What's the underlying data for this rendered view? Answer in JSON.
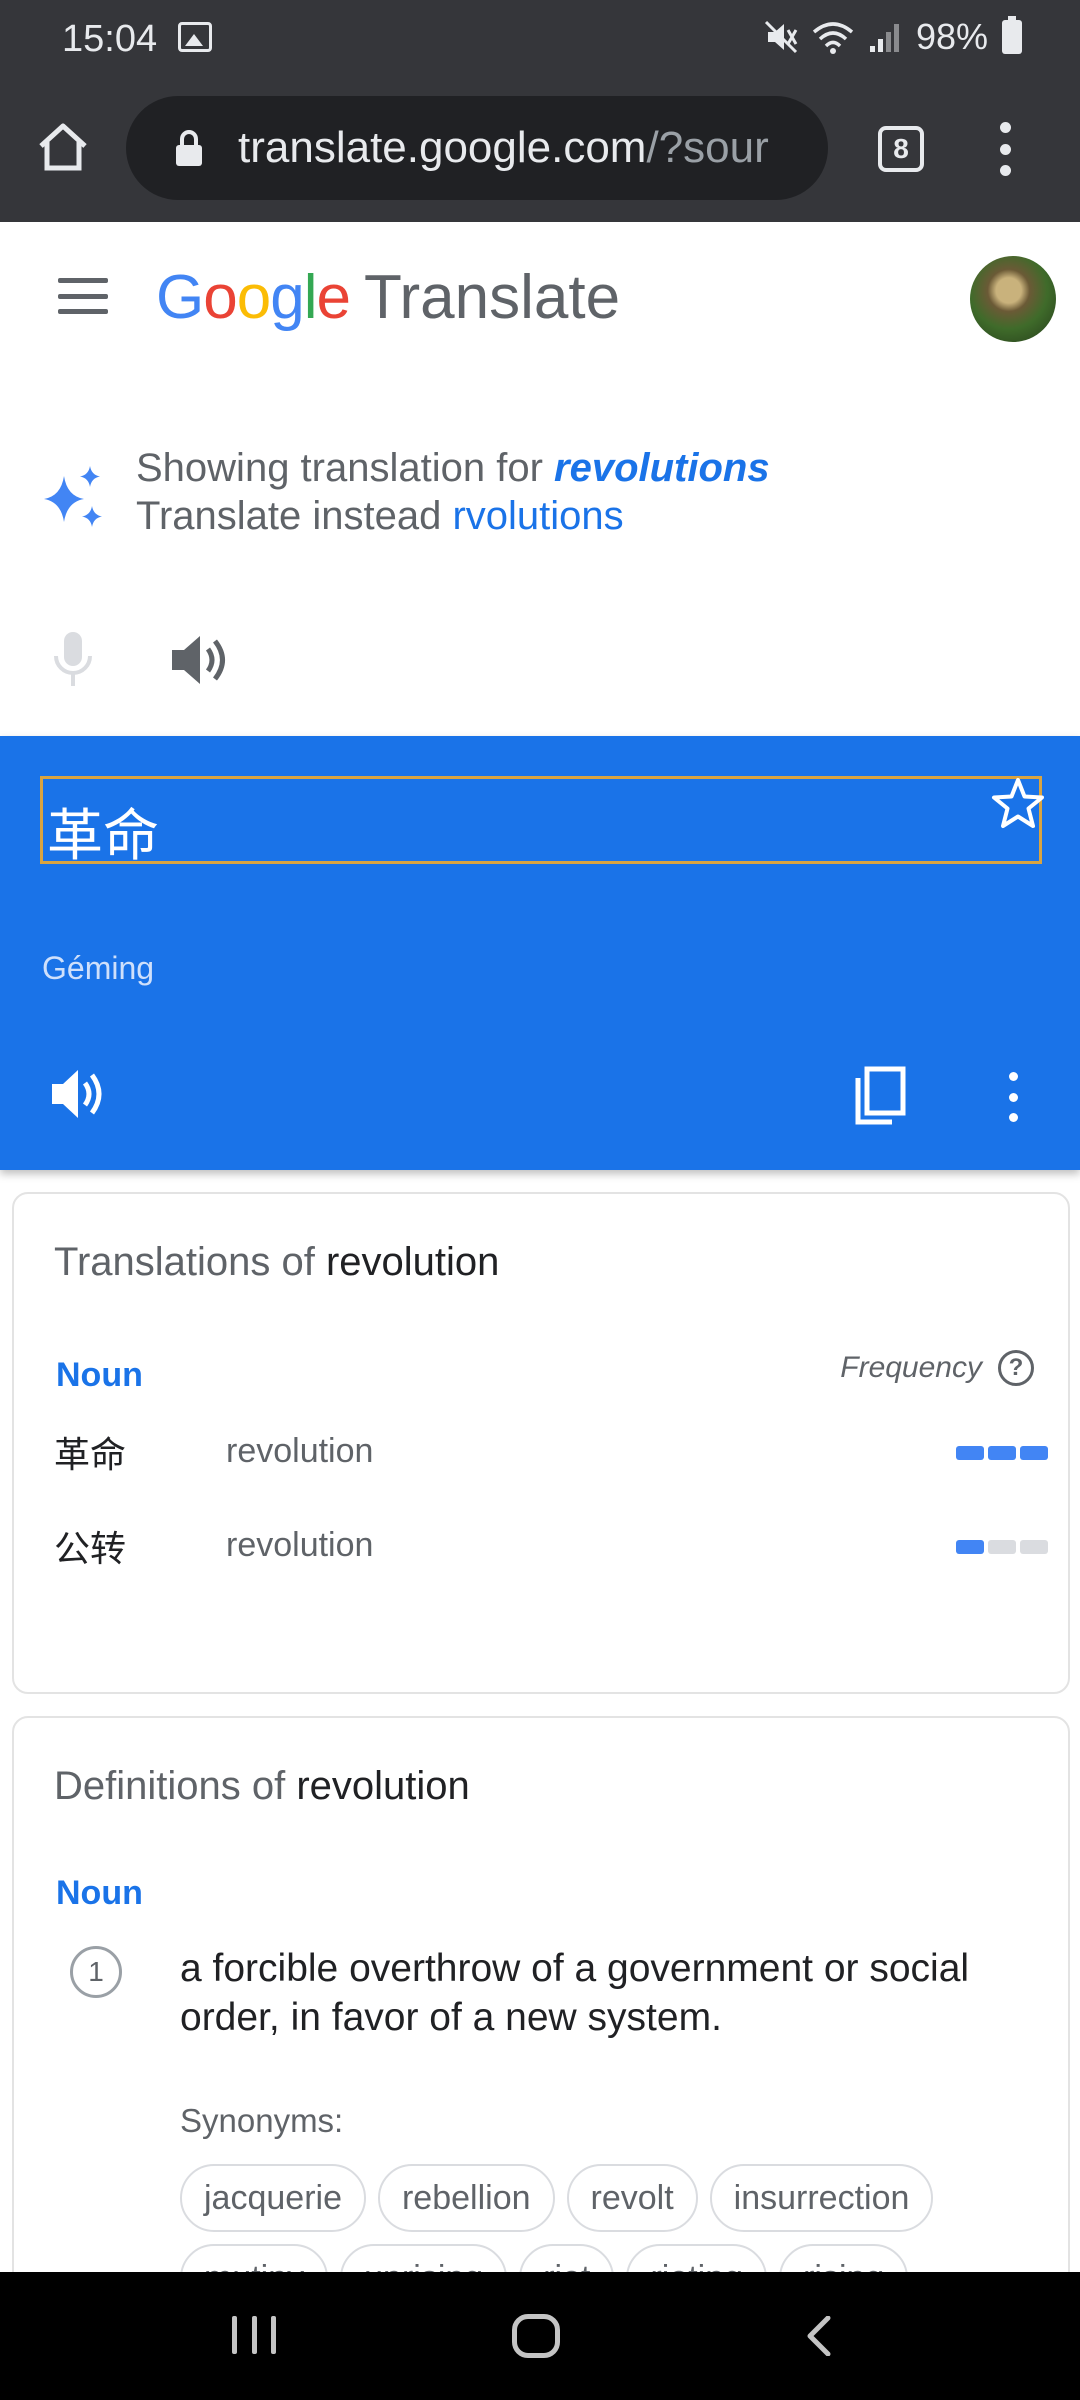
{
  "status_bar": {
    "time": "15:04",
    "battery": "98%"
  },
  "browser": {
    "url_host": "translate.google.com",
    "url_path": "/?sour",
    "tab_count": "8"
  },
  "header": {
    "logo_letters": [
      "G",
      "o",
      "o",
      "g",
      "l",
      "e"
    ],
    "product": "Translate"
  },
  "suggestion": {
    "showing_prefix": "Showing translation for ",
    "showing_word": "revolutions",
    "instead_prefix": "Translate instead ",
    "instead_word": "rvolutions"
  },
  "result": {
    "translation": "革命",
    "romanization": "Géming",
    "colors": {
      "background": "#1a73e8"
    }
  },
  "translations_card": {
    "title_prefix": "Translations of ",
    "title_word": "revolution",
    "part_of_speech": "Noun",
    "frequency_label": "Frequency",
    "help_symbol": "?",
    "rows": [
      {
        "word": "革命",
        "meaning": "revolution",
        "frequency_level": 3,
        "frequency_max": 3
      },
      {
        "word": "公转",
        "meaning": "revolution",
        "frequency_level": 1,
        "frequency_max": 3
      }
    ]
  },
  "definitions_card": {
    "title_prefix": "Definitions of ",
    "title_word": "revolution",
    "part_of_speech": "Noun",
    "definitions": [
      {
        "number": "1",
        "text": "a forcible overthrow of a government or social order, in favor of a new system.",
        "synonyms_label": "Synonyms:",
        "synonyms": [
          "jacquerie",
          "rebellion",
          "revolt",
          "insurrection",
          "mutiny",
          "uprising",
          "riot",
          "rioting",
          "rising"
        ]
      }
    ]
  },
  "icons": [
    "image-icon",
    "mute-icon",
    "wifi-icon",
    "signal-icon",
    "battery-icon",
    "home-icon",
    "lock-icon",
    "tabs-icon",
    "overflow-menu-icon",
    "hamburger-icon",
    "avatar",
    "sparkle-icon",
    "mic-icon",
    "speaker-icon",
    "star-icon",
    "copy-icon",
    "help-icon",
    "recents-icon",
    "nav-home-icon",
    "back-icon"
  ]
}
